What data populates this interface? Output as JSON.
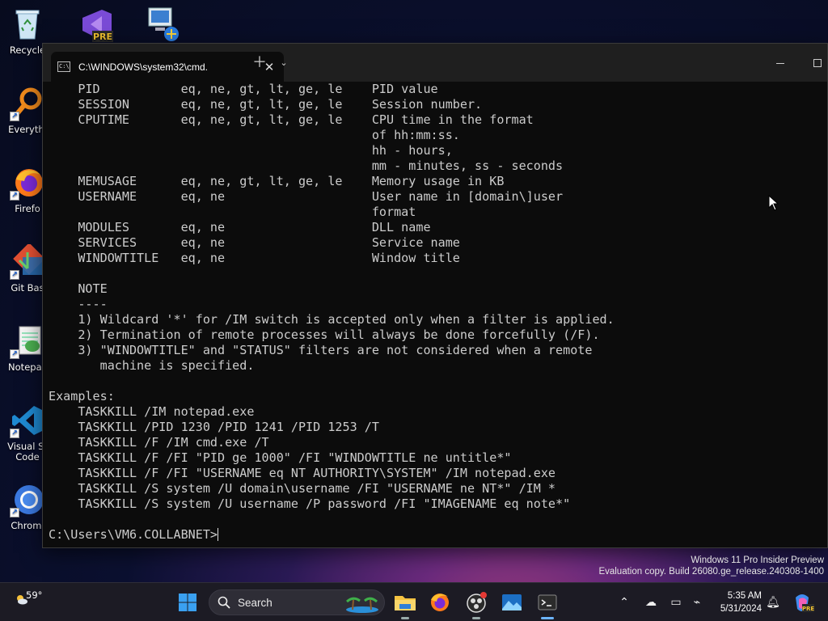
{
  "desktop": {
    "icons": [
      {
        "label": "Recycle",
        "name": "recycle-bin"
      },
      {
        "label": "Everythi",
        "name": "everything"
      },
      {
        "label": "Firefo",
        "name": "firefox"
      },
      {
        "label": "Git Bas",
        "name": "git-bash"
      },
      {
        "label": "Notepac",
        "name": "notepad"
      },
      {
        "label": "Visual St\nCode",
        "name": "visual-studio-code"
      },
      {
        "label": "Chromi",
        "name": "chromium"
      }
    ]
  },
  "terminal": {
    "tab_title": "C:\\WINDOWS\\system32\\cmd.",
    "cmd_icon_text": "C:\\",
    "lines": [
      "    PID           eq, ne, gt, lt, ge, le    PID value",
      "    SESSION       eq, ne, gt, lt, ge, le    Session number.",
      "    CPUTIME       eq, ne, gt, lt, ge, le    CPU time in the format",
      "                                            of hh:mm:ss.",
      "                                            hh - hours,",
      "                                            mm - minutes, ss - seconds",
      "    MEMUSAGE      eq, ne, gt, lt, ge, le    Memory usage in KB",
      "    USERNAME      eq, ne                    User name in [domain\\]user",
      "                                            format",
      "    MODULES       eq, ne                    DLL name",
      "    SERVICES      eq, ne                    Service name",
      "    WINDOWTITLE   eq, ne                    Window title",
      "",
      "    NOTE",
      "    ----",
      "    1) Wildcard '*' for /IM switch is accepted only when a filter is applied.",
      "    2) Termination of remote processes will always be done forcefully (/F).",
      "    3) \"WINDOWTITLE\" and \"STATUS\" filters are not considered when a remote",
      "       machine is specified.",
      "",
      "Examples:",
      "    TASKKILL /IM notepad.exe",
      "    TASKKILL /PID 1230 /PID 1241 /PID 1253 /T",
      "    TASKKILL /F /IM cmd.exe /T",
      "    TASKKILL /F /FI \"PID ge 1000\" /FI \"WINDOWTITLE ne untitle*\"",
      "    TASKKILL /F /FI \"USERNAME eq NT AUTHORITY\\SYSTEM\" /IM notepad.exe",
      "    TASKKILL /S system /U domain\\username /FI \"USERNAME ne NT*\" /IM *",
      "    TASKKILL /S system /U username /P password /FI \"IMAGENAME eq note*\"",
      ""
    ],
    "prompt": "C:\\Users\\VM6.COLLABNET>"
  },
  "watermark": {
    "line1": "Windows 11 Pro Insider Preview",
    "line2": "Evaluation copy. Build 26080.ge_release.240308-1400"
  },
  "taskbar": {
    "weather_temp": "59°",
    "search_placeholder": "Search",
    "time": "5:35 AM",
    "date": "5/31/2024"
  }
}
